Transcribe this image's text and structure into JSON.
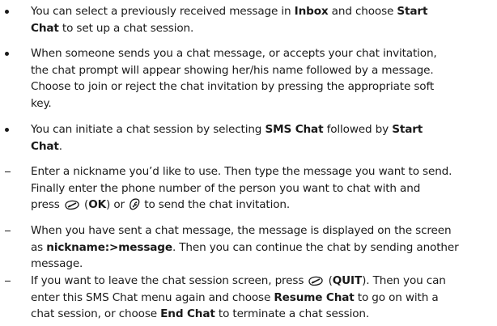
{
  "items": [
    {
      "lines": [
        [
          "You can select a previously received message in ",
          {
            "b": "Inbox"
          },
          " and choose ",
          {
            "b": "Start"
          }
        ],
        [
          {
            "b": "Chat"
          },
          " to set up a chat session."
        ]
      ]
    },
    {
      "lines": [
        [
          "When someone sends you a chat message, or accepts your chat invitation,"
        ],
        [
          "the chat prompt will appear showing her/his name followed by a message."
        ],
        [
          "Choose to join or reject the chat invitation by pressing the appropriate soft"
        ],
        [
          "key."
        ]
      ]
    },
    {
      "lines": [
        [
          "You can initiate a chat session by selecting ",
          {
            "b": "SMS Chat"
          },
          " followed by ",
          {
            "b": "Start"
          }
        ],
        [
          {
            "b": "Chat"
          },
          "."
        ]
      ]
    },
    {
      "lines": [
        [
          "Enter a nickname you’d like to use. Then type the message you want to send."
        ],
        [
          "Finally enter the phone number of the person you want to chat with and"
        ],
        [
          "press ",
          {
            "icon": "soft-key-icon"
          },
          " (",
          {
            "b": "OK"
          },
          ") or ",
          {
            "icon": "send-key-icon"
          },
          " to send the chat invitation."
        ]
      ]
    },
    {
      "lines": [
        [
          "When you have sent a chat message, the message is displayed on the screen"
        ],
        [
          "as ",
          {
            "b": "nickname:>message"
          },
          ". Then you can continue the chat by sending another"
        ],
        [
          "message."
        ]
      ]
    },
    {
      "lines": [
        [
          "If you want to leave the chat session screen, press ",
          {
            "icon": "soft-key-icon"
          },
          " (",
          {
            "b": "QUIT"
          },
          "). Then you can"
        ],
        [
          "enter this SMS Chat menu again and choose ",
          {
            "b": "Resume Chat"
          },
          " to go on with a"
        ],
        [
          "chat session, or choose ",
          {
            "b": "End Chat"
          },
          " to terminate a chat session."
        ]
      ]
    }
  ]
}
